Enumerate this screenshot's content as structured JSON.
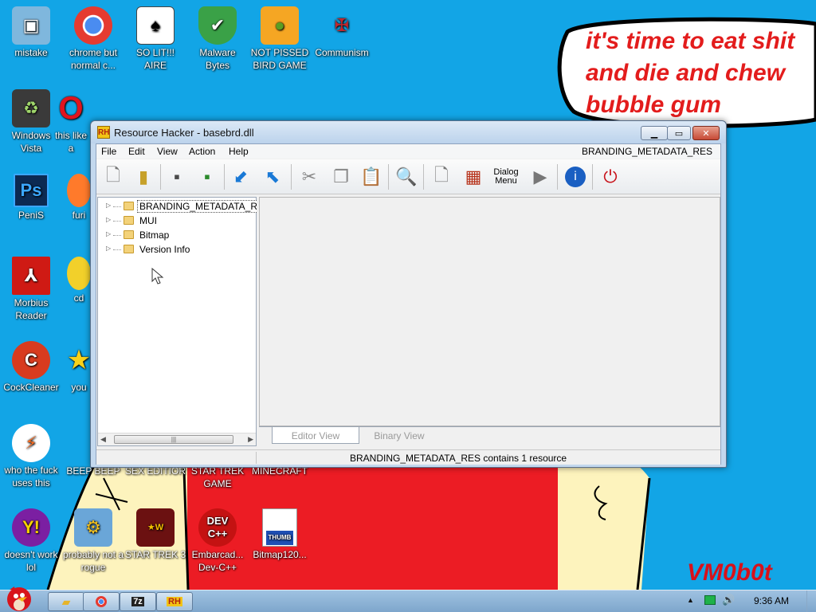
{
  "desktop": {
    "icons": [
      {
        "name": "mistake",
        "label": "mistake"
      },
      {
        "name": "chrome",
        "label": "chrome but normal c..."
      },
      {
        "name": "so-lit",
        "label": "SO LIT!!! AIRE"
      },
      {
        "name": "malware-bytes",
        "label": "Malware Bytes"
      },
      {
        "name": "not-pissed-bird",
        "label": "NOT PISSED BIRD GAME"
      },
      {
        "name": "communism",
        "label": "Communism"
      },
      {
        "name": "windows-vista",
        "label": "Windows Vista"
      },
      {
        "name": "this-like",
        "label": "this like a"
      },
      {
        "name": "penis",
        "label": "PeniS"
      },
      {
        "name": "fur",
        "label": "furi"
      },
      {
        "name": "morbius-reader",
        "label": "Morbius Reader"
      },
      {
        "name": "cd",
        "label": "cd"
      },
      {
        "name": "cockcleaner",
        "label": "CockCleaner"
      },
      {
        "name": "you",
        "label": "you"
      },
      {
        "name": "who-uses-this",
        "label": "who the fuck uses this"
      },
      {
        "name": "beep-beep",
        "label": "BEEP BEEP"
      },
      {
        "name": "sex-editior",
        "label": "SEX EDITIOR"
      },
      {
        "name": "star-trek-game",
        "label": "STAR TREK GAME"
      },
      {
        "name": "minecraft",
        "label": "MINECRAFT"
      },
      {
        "name": "doesnt-work",
        "label": "doesn't work lol"
      },
      {
        "name": "probably-not-rogue",
        "label": "probably not a rogue"
      },
      {
        "name": "star-trek-3",
        "label": "STAR TREK 3"
      },
      {
        "name": "dev-cpp",
        "label": "Embarcad... Dev-C++"
      },
      {
        "name": "bitmap",
        "label": "Bitmap120..."
      }
    ],
    "bubble_lines": [
      "it's time to eat shit",
      "and die and chew",
      "bubble gum"
    ],
    "watermark": "VM0b0t"
  },
  "window": {
    "title": "Resource Hacker - basebrd.dll",
    "app_icon_text": "RH",
    "menu": [
      "File",
      "Edit",
      "View",
      "Action",
      "Help"
    ],
    "resource_label": "BRANDING_METADATA_RES",
    "toolbar_dialog_label_1": "Dialog",
    "toolbar_dialog_label_2": "Menu",
    "tree": [
      {
        "label": "BRANDING_METADATA_RES"
      },
      {
        "label": "MUI"
      },
      {
        "label": "Bitmap"
      },
      {
        "label": "Version Info"
      }
    ],
    "tabs": {
      "editor": "Editor View",
      "binary": "Binary View"
    },
    "status": "BRANDING_METADATA_RES contains 1 resource"
  },
  "taskbar": {
    "clock": "9:36 AM",
    "apps": [
      "explorer",
      "chrome",
      "7z",
      "RH"
    ],
    "seven_zip_label": "7z",
    "rh_label": "RH"
  },
  "colors": {
    "desktop": "#12a5e6",
    "accent_red": "#e31c1c",
    "titlebar": "#c3d8ee"
  }
}
